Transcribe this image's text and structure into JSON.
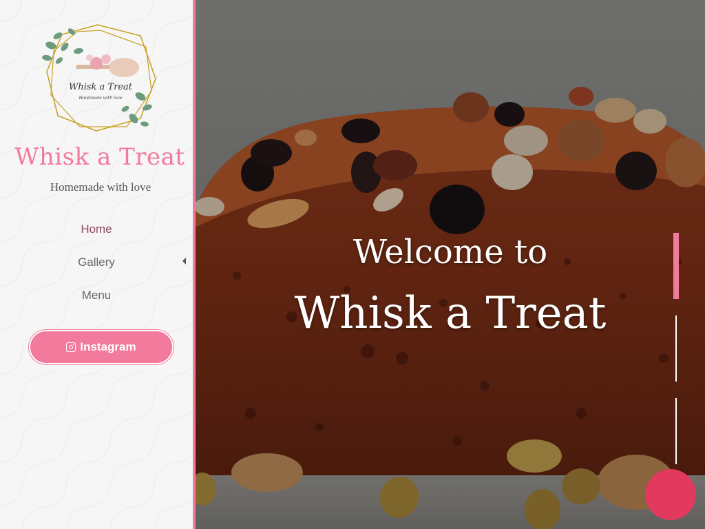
{
  "site": {
    "logo_alt": "Whisk a Treat",
    "title": "Whisk a Treat",
    "tagline": "Homemade with love"
  },
  "nav": {
    "items": [
      {
        "label": "Home",
        "active": true
      },
      {
        "label": "Gallery",
        "has_submenu": true
      },
      {
        "label": "Menu"
      }
    ]
  },
  "instagram": {
    "label": "Instagram",
    "icon": "instagram-icon"
  },
  "hero": {
    "welcome": "Welcome to",
    "brand": "Whisk a Treat",
    "slides_count": 3,
    "active_slide": 1
  },
  "colors": {
    "accent": "#f27a9c",
    "chat": "#e23a5f",
    "nav_active": "#8c4a5e"
  }
}
